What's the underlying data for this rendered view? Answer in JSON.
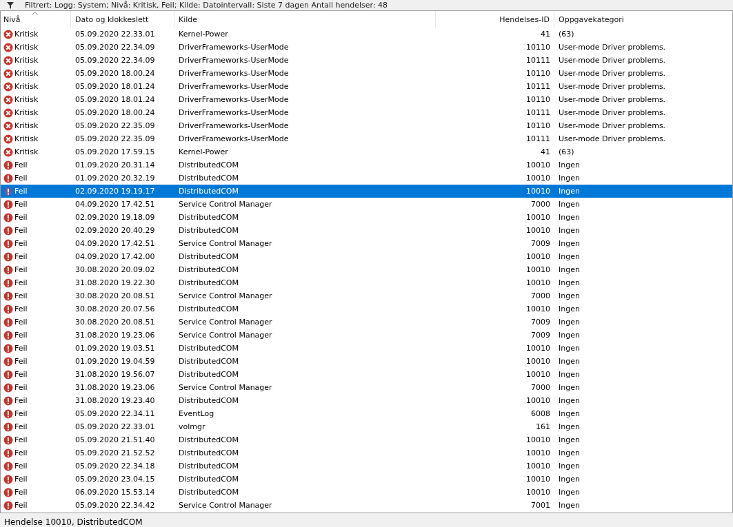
{
  "filter_bar": {
    "text": "Filtrert: Logg: System; Nivå: Kritisk, Feil; Kilde: Datointervall: Siste 7 dagen Antall hendelser: 48"
  },
  "table": {
    "columns": [
      "Nivå",
      "Dato og klokkeslett",
      "Kilde",
      "Hendelses-ID",
      "Oppgavekategori"
    ],
    "rows": [
      {
        "kind": "critical",
        "level": "Kritisk",
        "date": "05.09.2020 22.33.01",
        "source": "Kernel-Power",
        "id": "41",
        "category": "(63)",
        "selected": false
      },
      {
        "kind": "critical",
        "level": "Kritisk",
        "date": "05.09.2020 22.34.09",
        "source": "DriverFrameworks-UserMode",
        "id": "10110",
        "category": "User-mode Driver problems.",
        "selected": false
      },
      {
        "kind": "critical",
        "level": "Kritisk",
        "date": "05.09.2020 22.34.09",
        "source": "DriverFrameworks-UserMode",
        "id": "10111",
        "category": "User-mode Driver problems.",
        "selected": false
      },
      {
        "kind": "critical",
        "level": "Kritisk",
        "date": "05.09.2020 18.00.24",
        "source": "DriverFrameworks-UserMode",
        "id": "10110",
        "category": "User-mode Driver problems.",
        "selected": false
      },
      {
        "kind": "critical",
        "level": "Kritisk",
        "date": "05.09.2020 18.01.24",
        "source": "DriverFrameworks-UserMode",
        "id": "10111",
        "category": "User-mode Driver problems.",
        "selected": false
      },
      {
        "kind": "critical",
        "level": "Kritisk",
        "date": "05.09.2020 18.01.24",
        "source": "DriverFrameworks-UserMode",
        "id": "10110",
        "category": "User-mode Driver problems.",
        "selected": false
      },
      {
        "kind": "critical",
        "level": "Kritisk",
        "date": "05.09.2020 18.00.24",
        "source": "DriverFrameworks-UserMode",
        "id": "10111",
        "category": "User-mode Driver problems.",
        "selected": false
      },
      {
        "kind": "critical",
        "level": "Kritisk",
        "date": "05.09.2020 22.35.09",
        "source": "DriverFrameworks-UserMode",
        "id": "10110",
        "category": "User-mode Driver problems.",
        "selected": false
      },
      {
        "kind": "critical",
        "level": "Kritisk",
        "date": "05.09.2020 22.35.09",
        "source": "DriverFrameworks-UserMode",
        "id": "10111",
        "category": "User-mode Driver problems.",
        "selected": false
      },
      {
        "kind": "critical",
        "level": "Kritisk",
        "date": "05.09.2020 17.59.15",
        "source": "Kernel-Power",
        "id": "41",
        "category": "(63)",
        "selected": false
      },
      {
        "kind": "error",
        "level": "Feil",
        "date": "01.09.2020 20.31.14",
        "source": "DistributedCOM",
        "id": "10010",
        "category": "Ingen",
        "selected": false
      },
      {
        "kind": "error",
        "level": "Feil",
        "date": "01.09.2020 20.32.19",
        "source": "DistributedCOM",
        "id": "10010",
        "category": "Ingen",
        "selected": false
      },
      {
        "kind": "error",
        "level": "Feil",
        "date": "02.09.2020 19.19.17",
        "source": "DistributedCOM",
        "id": "10010",
        "category": "Ingen",
        "selected": true
      },
      {
        "kind": "error",
        "level": "Feil",
        "date": "04.09.2020 17.42.51",
        "source": "Service Control Manager",
        "id": "7000",
        "category": "Ingen",
        "selected": false
      },
      {
        "kind": "error",
        "level": "Feil",
        "date": "02.09.2020 19.18.09",
        "source": "DistributedCOM",
        "id": "10010",
        "category": "Ingen",
        "selected": false
      },
      {
        "kind": "error",
        "level": "Feil",
        "date": "02.09.2020 20.40.29",
        "source": "DistributedCOM",
        "id": "10010",
        "category": "Ingen",
        "selected": false
      },
      {
        "kind": "error",
        "level": "Feil",
        "date": "04.09.2020 17.42.51",
        "source": "Service Control Manager",
        "id": "7009",
        "category": "Ingen",
        "selected": false
      },
      {
        "kind": "error",
        "level": "Feil",
        "date": "04.09.2020 17.42.00",
        "source": "DistributedCOM",
        "id": "10010",
        "category": "Ingen",
        "selected": false
      },
      {
        "kind": "error",
        "level": "Feil",
        "date": "30.08.2020 20.09.02",
        "source": "DistributedCOM",
        "id": "10010",
        "category": "Ingen",
        "selected": false
      },
      {
        "kind": "error",
        "level": "Feil",
        "date": "31.08.2020 19.22.30",
        "source": "DistributedCOM",
        "id": "10010",
        "category": "Ingen",
        "selected": false
      },
      {
        "kind": "error",
        "level": "Feil",
        "date": "30.08.2020 20.08.51",
        "source": "Service Control Manager",
        "id": "7000",
        "category": "Ingen",
        "selected": false
      },
      {
        "kind": "error",
        "level": "Feil",
        "date": "30.08.2020 20.07.56",
        "source": "DistributedCOM",
        "id": "10010",
        "category": "Ingen",
        "selected": false
      },
      {
        "kind": "error",
        "level": "Feil",
        "date": "30.08.2020 20.08.51",
        "source": "Service Control Manager",
        "id": "7009",
        "category": "Ingen",
        "selected": false
      },
      {
        "kind": "error",
        "level": "Feil",
        "date": "31.08.2020 19.23.06",
        "source": "Service Control Manager",
        "id": "7009",
        "category": "Ingen",
        "selected": false
      },
      {
        "kind": "error",
        "level": "Feil",
        "date": "01.09.2020 19.03.51",
        "source": "DistributedCOM",
        "id": "10010",
        "category": "Ingen",
        "selected": false
      },
      {
        "kind": "error",
        "level": "Feil",
        "date": "01.09.2020 19.04.59",
        "source": "DistributedCOM",
        "id": "10010",
        "category": "Ingen",
        "selected": false
      },
      {
        "kind": "error",
        "level": "Feil",
        "date": "31.08.2020 19.56.07",
        "source": "DistributedCOM",
        "id": "10010",
        "category": "Ingen",
        "selected": false
      },
      {
        "kind": "error",
        "level": "Feil",
        "date": "31.08.2020 19.23.06",
        "source": "Service Control Manager",
        "id": "7000",
        "category": "Ingen",
        "selected": false
      },
      {
        "kind": "error",
        "level": "Feil",
        "date": "31.08.2020 19.23.40",
        "source": "DistributedCOM",
        "id": "10010",
        "category": "Ingen",
        "selected": false
      },
      {
        "kind": "error",
        "level": "Feil",
        "date": "05.09.2020 22.34.11",
        "source": "EventLog",
        "id": "6008",
        "category": "Ingen",
        "selected": false
      },
      {
        "kind": "error",
        "level": "Feil",
        "date": "05.09.2020 22.33.01",
        "source": "volmgr",
        "id": "161",
        "category": "Ingen",
        "selected": false
      },
      {
        "kind": "error",
        "level": "Feil",
        "date": "05.09.2020 21.51.40",
        "source": "DistributedCOM",
        "id": "10010",
        "category": "Ingen",
        "selected": false
      },
      {
        "kind": "error",
        "level": "Feil",
        "date": "05.09.2020 21.52.52",
        "source": "DistributedCOM",
        "id": "10010",
        "category": "Ingen",
        "selected": false
      },
      {
        "kind": "error",
        "level": "Feil",
        "date": "05.09.2020 22.34.18",
        "source": "DistributedCOM",
        "id": "10010",
        "category": "Ingen",
        "selected": false
      },
      {
        "kind": "error",
        "level": "Feil",
        "date": "05.09.2020 23.04.15",
        "source": "DistributedCOM",
        "id": "10010",
        "category": "Ingen",
        "selected": false
      },
      {
        "kind": "error",
        "level": "Feil",
        "date": "06.09.2020 15.53.14",
        "source": "DistributedCOM",
        "id": "10010",
        "category": "Ingen",
        "selected": false
      },
      {
        "kind": "error",
        "level": "Feil",
        "date": "05.09.2020 22.34.42",
        "source": "Service Control Manager",
        "id": "7001",
        "category": "Ingen",
        "selected": false
      }
    ]
  },
  "status_bar": {
    "text": "Hendelse 10010, DistributedCOM"
  }
}
